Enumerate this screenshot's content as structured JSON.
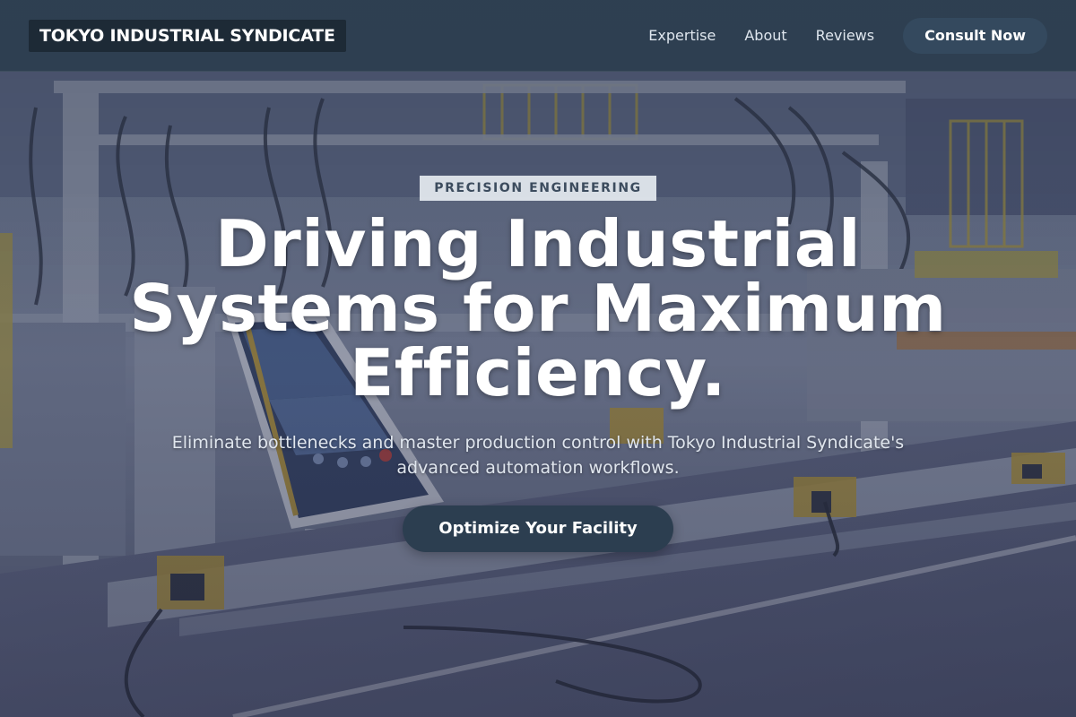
{
  "navbar": {
    "brand": "TOKYO INDUSTRIAL SYNDICATE",
    "links": [
      "Expertise",
      "About",
      "Reviews"
    ],
    "cta": "Consult Now"
  },
  "hero": {
    "eyebrow": "PRECISION ENGINEERING",
    "headline": "Driving Industrial Systems for Maximum Efficiency.",
    "subhead": "Eliminate bottlenecks and master production control with Tokyo Industrial Syndicate's advanced automation workflows.",
    "cta": "Optimize Your Facility",
    "background": "factory-automation-line-photo"
  },
  "colors": {
    "navbar_bg": "#2c3e50",
    "brand_bg": "#1d2a36",
    "cta_bg": "#2c3e50",
    "nav_cta_bg": "#34495e",
    "eyebrow_bg": "#e6eaf0",
    "eyebrow_text": "#3c4c5e",
    "text_light": "#ffffff"
  }
}
